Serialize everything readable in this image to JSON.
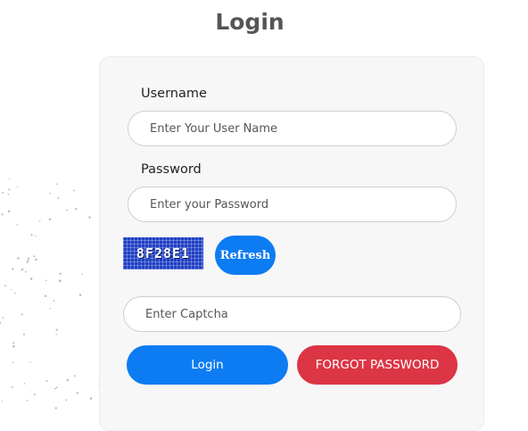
{
  "page": {
    "title": "Login"
  },
  "form": {
    "username_label": "Username",
    "username_placeholder": "Enter Your User Name",
    "password_label": "Password",
    "password_placeholder": "Enter your Password",
    "captcha_text": "8F28E1",
    "refresh_label": "Refresh",
    "captcha_placeholder": "Enter Captcha",
    "login_label": "Login",
    "forgot_label": "FORGOT PASSWORD"
  },
  "colors": {
    "primary": "#0d7bf2",
    "danger": "#dc3545",
    "captcha_bg": "#1f3fc4"
  }
}
